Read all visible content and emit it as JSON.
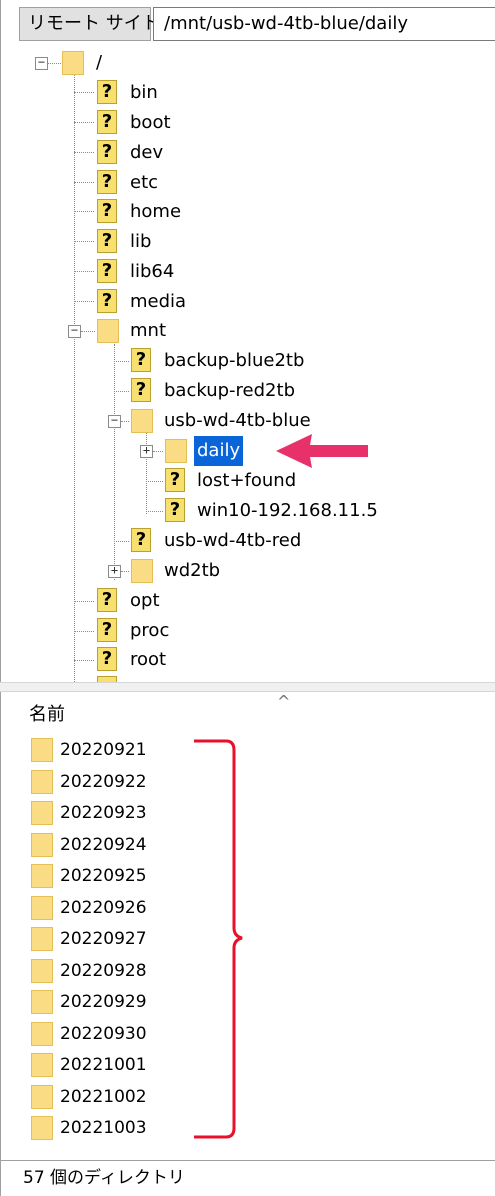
{
  "remote": {
    "label": "リモート サイト:",
    "path": "/mnt/usb-wd-4tb-blue/daily"
  },
  "tree": {
    "root": "/",
    "top_items": [
      "bin",
      "boot",
      "dev",
      "etc",
      "home",
      "lib",
      "lib64",
      "media"
    ],
    "mnt": "mnt",
    "mnt_children": [
      "backup-blue2tb",
      "backup-red2tb"
    ],
    "blue": "usb-wd-4tb-blue",
    "daily": "daily",
    "blue_children": [
      "lost+found",
      "win10-192.168.11.5"
    ],
    "red": "usb-wd-4tb-red",
    "wd2tb": "wd2tb",
    "bottom_items": [
      "opt",
      "proc",
      "root"
    ]
  },
  "list": {
    "header": "名前",
    "files": [
      "20220921",
      "20220922",
      "20220923",
      "20220924",
      "20220925",
      "20220926",
      "20220927",
      "20220928",
      "20220929",
      "20220930",
      "20221001",
      "20221002",
      "20221003"
    ]
  },
  "status": "57 個のディレクトリ",
  "colors": {
    "selection": "#0a66d8",
    "annotation": "#e8316a",
    "bracket": "#e8102a"
  },
  "icons": {
    "unknown_folder": "question-mark-icon",
    "folder": "folder-icon"
  }
}
